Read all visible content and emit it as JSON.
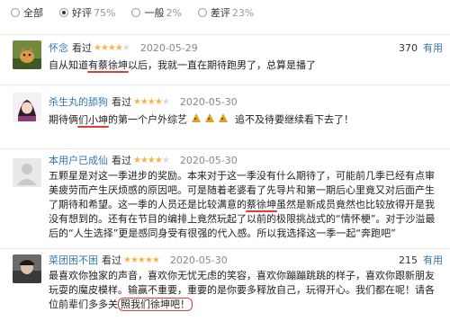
{
  "filters": [
    {
      "label": "全部",
      "pct": "",
      "selected": false
    },
    {
      "label": "好评",
      "pct": "75%",
      "selected": true
    },
    {
      "label": "一般",
      "pct": "2%",
      "selected": false
    },
    {
      "label": "差评",
      "pct": "23%",
      "selected": false
    }
  ],
  "reviews": [
    {
      "user": "怀念",
      "watched": "看过",
      "rating": 4,
      "date": "2020-05-29",
      "votes": "370",
      "useful": "有用",
      "text_a": "自从知道",
      "text_hl": "有蔡徐坤",
      "text_b": "以后，我就一直在期待跑男了，总算是播了"
    },
    {
      "user": "杀生丸的舔狗",
      "watched": "看过",
      "rating": 4,
      "date": "2020-05-30",
      "votes": "",
      "useful": "",
      "text_a": "期待俩",
      "text_hl": "们小坤",
      "text_b": "的第一个户外综艺",
      "text_c": "追不及待要继续看下去了！"
    },
    {
      "user": "本用户已成仙",
      "watched": "看过",
      "rating": 4,
      "date": "2020-05-30",
      "votes": "",
      "useful": "",
      "text_a": "五颗星是对这一季进步的奖励。本来对于这一季没有什么期待了，可能前几季已经有点审美疲劳而产生厌烦感的原因吧。可是随着老婆看了先导片和第一期后心里竟又对后面产生了期待和希望。这一季的人员还是比较满意的",
      "text_hl": "蔡徐坤",
      "text_b": "虽然是新成员竟然也比较放得开是我没有想到的。还有在节目的编排上竟然玩起了以前的极限挑战式的“情怀梗”。对于沙溢最后的“人生选择”更是感同身受有很强的代入感。所以我选择这一季一起“奔跑吧”"
    },
    {
      "user": "菜团困不困",
      "watched": "看过",
      "rating": 5,
      "date": "2020-05-30",
      "votes": "215",
      "useful": "有用",
      "text_a": "最喜欢你独家的声音，喜欢你无忧无虑的笑容，喜欢你蹦蹦跳跳的样子，喜欢你跟新朋友玩耍的魔皮模样。输赢不重要，重要的是你要多释放自己，玩得开心。我们都在呢！请各位前辈们多多关",
      "text_hl": "照我们徐坤吧！"
    }
  ]
}
